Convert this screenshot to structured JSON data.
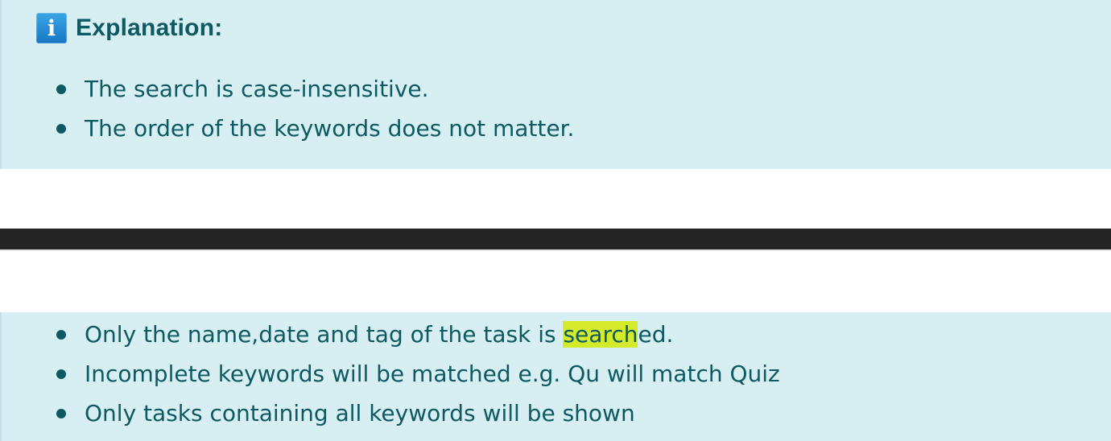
{
  "explanation_box": {
    "icon": "info-icon",
    "icon_glyph": "i",
    "title": "Explanation:",
    "items": [
      "The search is case-insensitive.",
      "The order of the keywords does not matter."
    ]
  },
  "notes_box": {
    "items": [
      {
        "before": "Only the name,date and tag of the task is ",
        "highlight": "search",
        "after": "ed."
      },
      {
        "text": "Incomplete keywords will be matched e.g. Qu will match Quiz"
      },
      {
        "text": "Only tasks containing all keywords will be shown"
      }
    ]
  },
  "colors": {
    "box_background": "#d7eef2",
    "text": "#0d5a63",
    "highlight": "#d4eb2c",
    "divider_bar": "#252525",
    "icon_blue": "#1677c4"
  }
}
